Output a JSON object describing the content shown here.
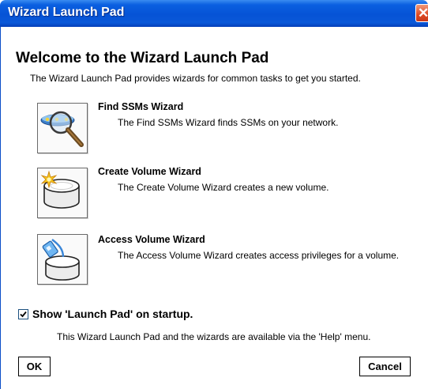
{
  "window": {
    "title": "Wizard Launch Pad",
    "close_symbol": "✕"
  },
  "heading": "Welcome to the Wizard Launch Pad",
  "intro": "The Wizard Launch Pad provides wizards for common tasks to get you started.",
  "wizards": [
    {
      "title": "Find SSMs Wizard",
      "description": "The Find SSMs Wizard finds SSMs on your network.",
      "icon": "magnifier-network-icon"
    },
    {
      "title": "Create Volume Wizard",
      "description": "The Create Volume Wizard creates a new volume.",
      "icon": "new-volume-icon"
    },
    {
      "title": "Access Volume Wizard",
      "description": "The Access Volume Wizard creates access privileges for a volume.",
      "icon": "volume-access-icon"
    }
  ],
  "startup": {
    "label": "Show 'Launch Pad' on startup.",
    "checked": true
  },
  "help_note": "This Wizard Launch Pad and the wizards are available via the 'Help' menu.",
  "buttons": {
    "ok": "OK",
    "cancel": "Cancel"
  },
  "colors": {
    "titlebar": "#0653d6",
    "close_button": "#de4a22",
    "background": "#ffffff"
  }
}
